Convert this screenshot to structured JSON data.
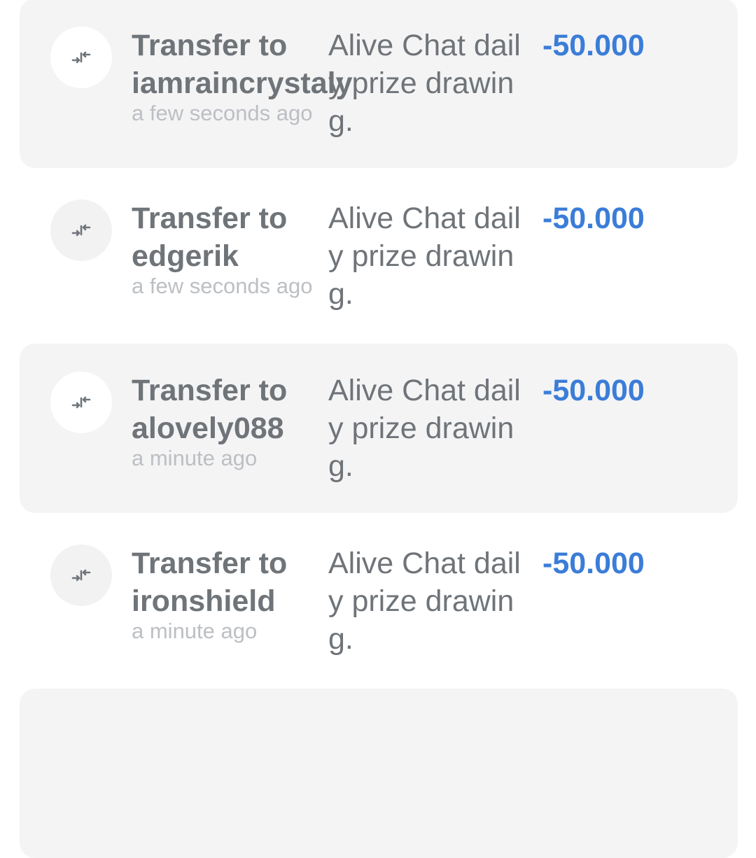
{
  "transactions": [
    {
      "title_line1": "Transfer to",
      "title_line2": "iamraincrystaly",
      "time": "a few seconds ago",
      "memo_line1": "Alive Chat dail",
      "memo_line2": "y prize drawin",
      "memo_line3": "g.",
      "amount": "-50.000",
      "icon": "transfer-arrows-icon"
    },
    {
      "title_line1": "Transfer to",
      "title_line2": "edgerik",
      "time": "a few seconds ago",
      "memo_line1": "Alive Chat dail",
      "memo_line2": "y prize drawin",
      "memo_line3": "g.",
      "amount": "-50.000",
      "icon": "transfer-arrows-icon"
    },
    {
      "title_line1": "Transfer to",
      "title_line2": "alovely088",
      "time": "a minute ago",
      "memo_line1": "Alive Chat dail",
      "memo_line2": "y prize drawin",
      "memo_line3": "g.",
      "amount": "-50.000",
      "icon": "transfer-arrows-icon"
    },
    {
      "title_line1": "Transfer to",
      "title_line2": "ironshield",
      "time": "a minute ago",
      "memo_line1": "Alive Chat dail",
      "memo_line2": "y prize drawin",
      "memo_line3": "g.",
      "amount": "-50.000",
      "icon": "transfer-arrows-icon"
    }
  ],
  "colors": {
    "amount": "#3b7dd8",
    "title": "#6f7479",
    "time": "#bcbfc3",
    "shaded_row": "#f4f4f5"
  }
}
